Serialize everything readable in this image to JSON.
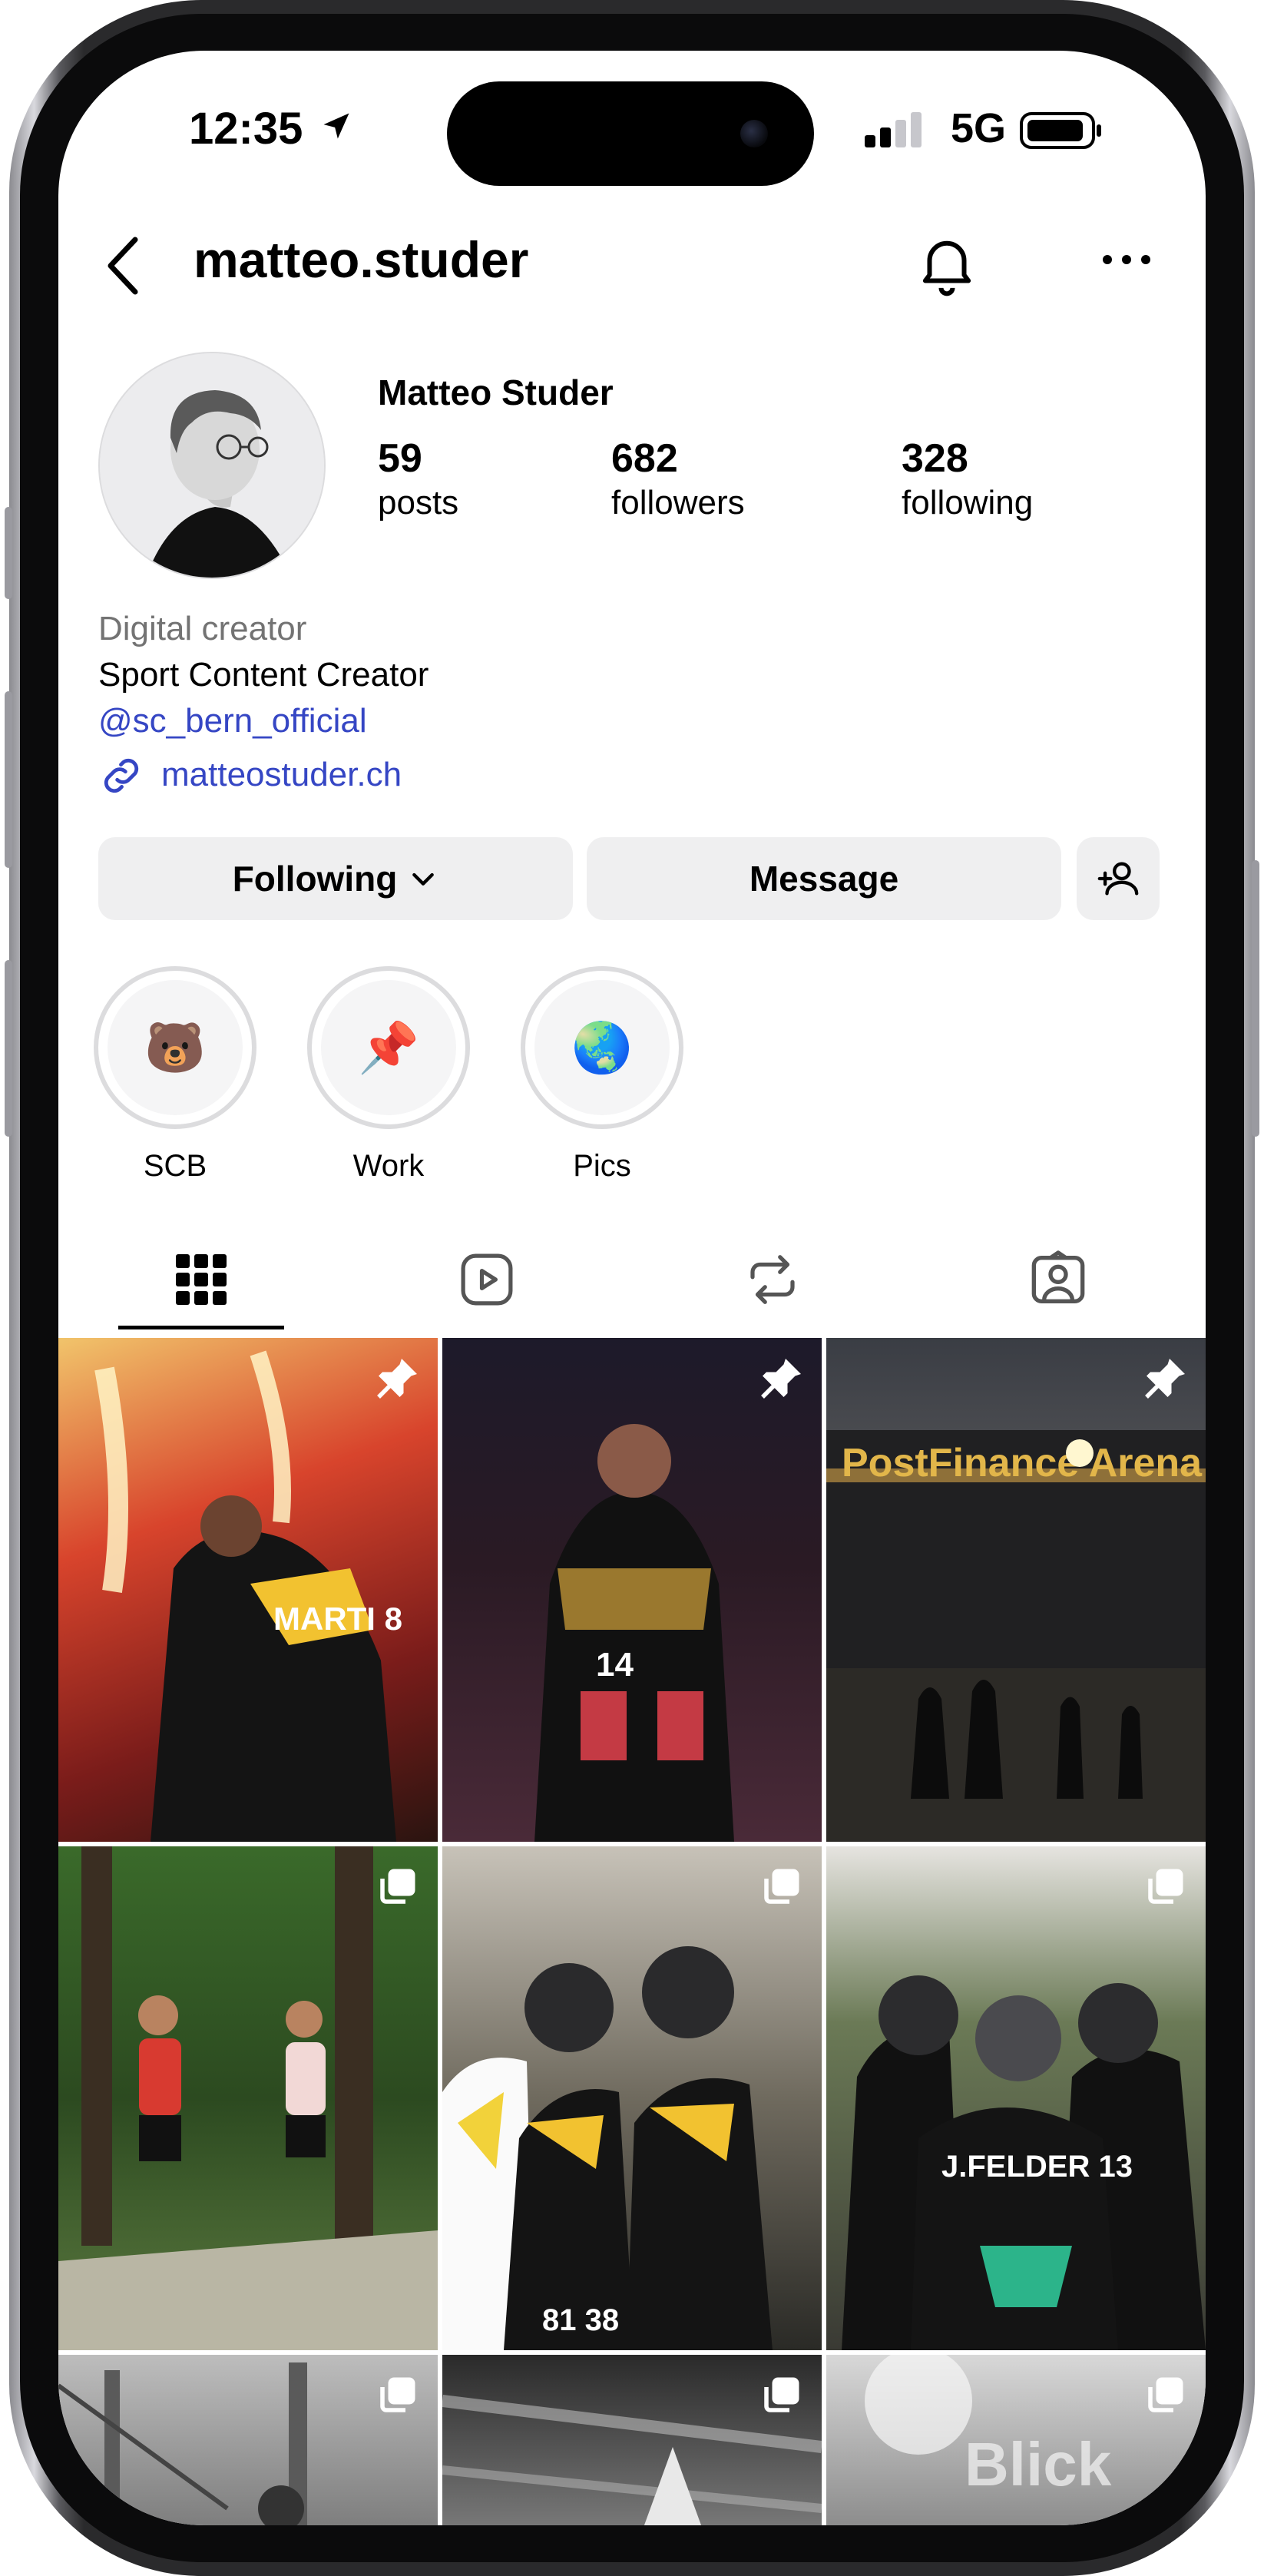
{
  "status": {
    "time": "12:35",
    "network": "5G"
  },
  "header": {
    "username": "matteo.studer"
  },
  "profile": {
    "name": "Matteo Studer",
    "stats": [
      {
        "value": "59",
        "label": "posts"
      },
      {
        "value": "682",
        "label": "followers"
      },
      {
        "value": "328",
        "label": "following"
      }
    ],
    "category": "Digital creator",
    "bio": "Sport Content Creator",
    "mention": "@sc_bern_official",
    "link": "matteostuder.ch"
  },
  "actions": {
    "following": "Following",
    "message": "Message"
  },
  "highlights": [
    {
      "label": "SCB",
      "emoji": "🐻"
    },
    {
      "label": "Work",
      "emoji": "📌"
    },
    {
      "label": "Pics",
      "emoji": "🌏"
    }
  ],
  "tabs": [
    "grid-icon",
    "reels-icon",
    "reposts-icon",
    "tagged-icon"
  ],
  "posts": [
    {
      "badge": "pin",
      "caption": "MARTI 8"
    },
    {
      "badge": "pin",
      "caption": "14"
    },
    {
      "badge": "pin",
      "caption": "PostFinance Arena"
    },
    {
      "badge": "multi",
      "caption": ""
    },
    {
      "badge": "multi",
      "caption": "81  38"
    },
    {
      "badge": "multi",
      "caption": "J.FELDER 13"
    },
    {
      "badge": "multi",
      "caption": ""
    },
    {
      "badge": "multi",
      "caption": ""
    },
    {
      "badge": "multi",
      "caption": "Blick"
    }
  ]
}
